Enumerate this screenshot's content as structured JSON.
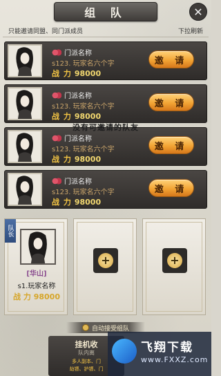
{
  "window": {
    "title": "组 队",
    "close_icon": "close-icon"
  },
  "subheader": {
    "left_text": "只能邀请同盟、同门派成员",
    "right_text": "下拉刷新"
  },
  "members": [
    {
      "guild": "门派名称",
      "name": "s123. 玩家名六个字",
      "power_label": "战 力",
      "power_value": "98000",
      "invite_label": "邀 请"
    },
    {
      "guild": "门派名称",
      "name": "s123. 玩家名六个字",
      "power_label": "战 力",
      "power_value": "98000",
      "invite_label": "邀 请"
    },
    {
      "guild": "门派名称",
      "name": "s123. 玩家名六个字",
      "power_label": "战 力",
      "power_value": "98000",
      "invite_label": "邀 请"
    },
    {
      "guild": "门派名称",
      "name": "s123. 玩家名六个字",
      "power_label": "战 力",
      "power_value": "98000",
      "invite_label": "邀 请"
    }
  ],
  "empty_hint": "没有可邀请的队友",
  "team": {
    "leader_tag": "队长",
    "leader_sect": "[华山]",
    "leader_name": "s1.玩家名称",
    "leader_power_label": "战 力",
    "leader_power_value": "98000",
    "add_icon": "+"
  },
  "auto_accept": {
    "label": "自动接受组队"
  },
  "bottom": {
    "title": "挂机收",
    "subtitle": "队内离",
    "line1": "多人副本、门",
    "line2": "劫镖、护镖、门"
  },
  "watermark": {
    "title": "飞翔下载",
    "url": "www.FXXZ.com"
  }
}
